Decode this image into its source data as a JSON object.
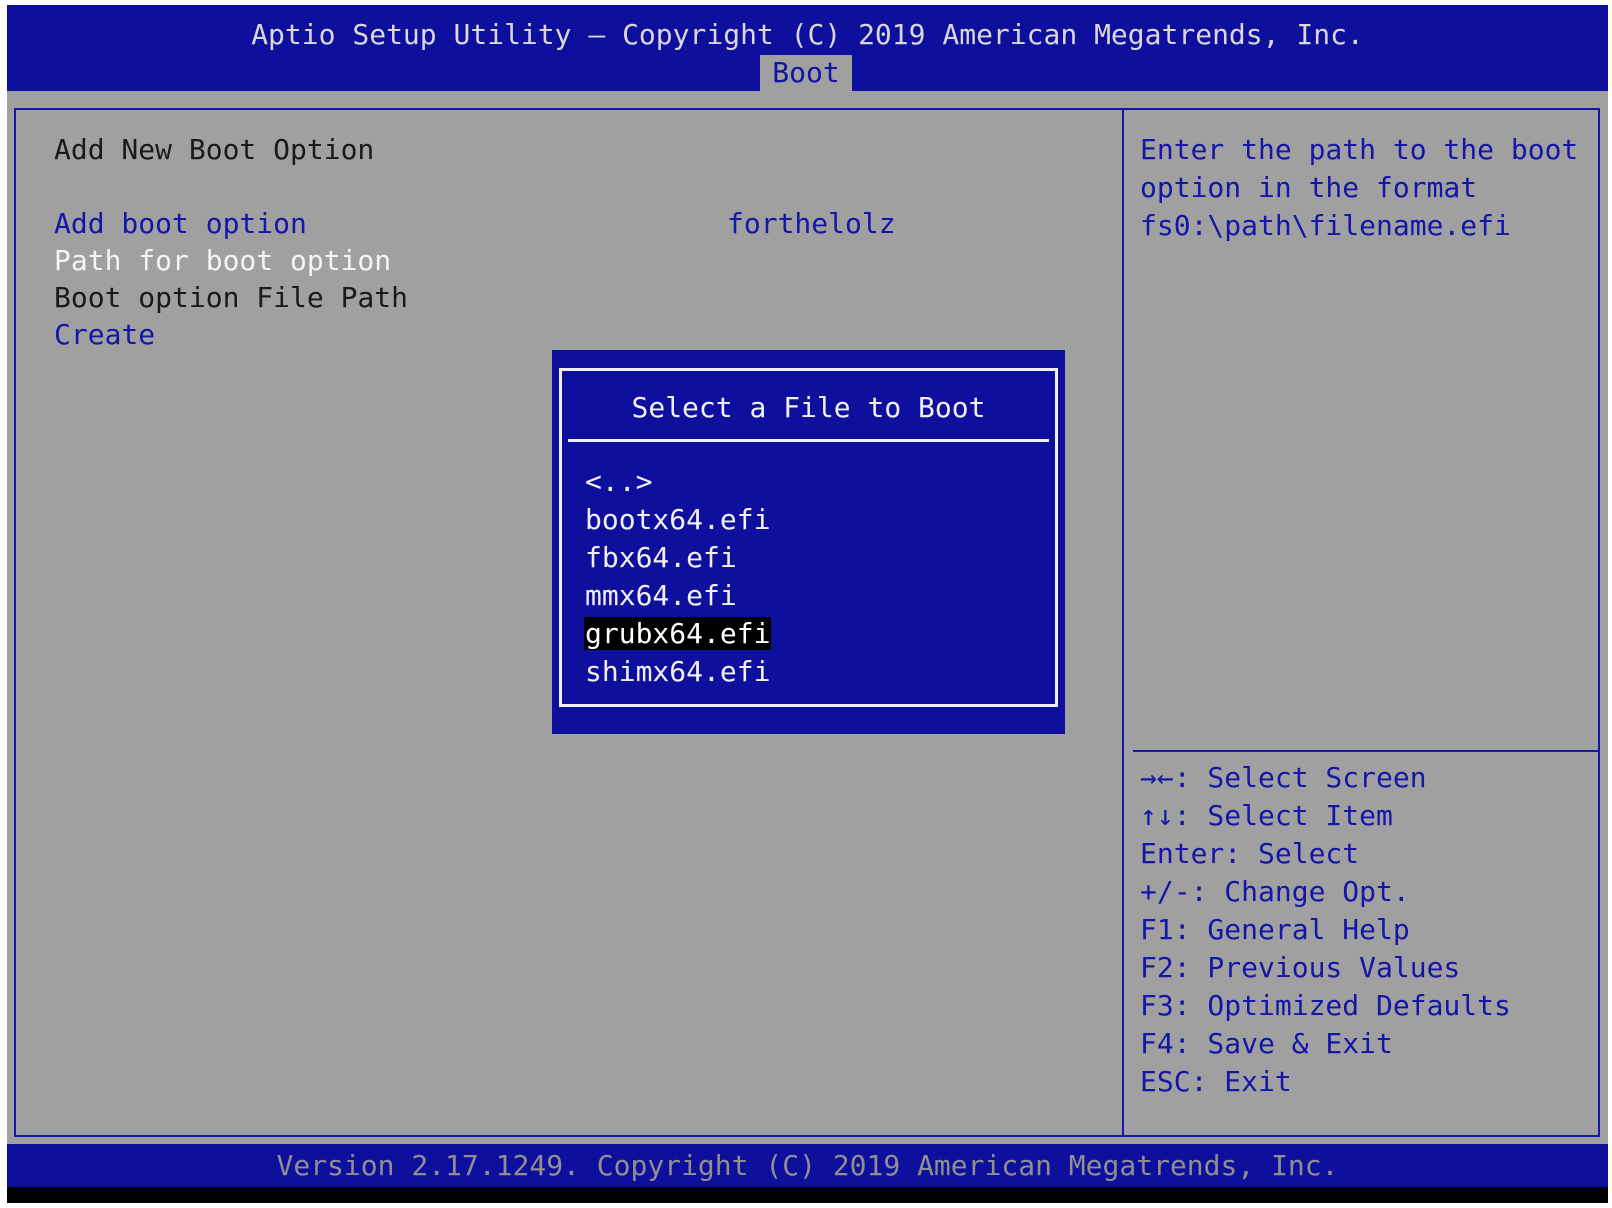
{
  "header": {
    "title": "Aptio Setup Utility – Copyright (C) 2019 American Megatrends, Inc.",
    "active_tab": "Boot"
  },
  "main": {
    "section_title": "Add New Boot Option",
    "items": [
      {
        "label": "Add boot option",
        "value": "forthelolz"
      },
      {
        "label": "Path for boot option"
      },
      {
        "label": "Boot option File Path"
      },
      {
        "label": "Create"
      }
    ]
  },
  "help": {
    "lines": [
      "Enter the path to the boot",
      "option in the format",
      "fs0:\\path\\filename.efi"
    ]
  },
  "keys": [
    "→←: Select Screen",
    "↑↓: Select Item",
    "Enter: Select",
    "+/-: Change Opt.",
    "F1: General Help",
    "F2: Previous Values",
    "F3: Optimized Defaults",
    "F4: Save & Exit",
    "ESC: Exit"
  ],
  "dialog": {
    "title": "Select a File to Boot",
    "files": [
      "<..>",
      "bootx64.efi",
      "fbx64.efi",
      "mmx64.efi",
      "grubx64.efi",
      "shimx64.efi"
    ],
    "selected": "grubx64.efi"
  },
  "footer": {
    "text": "Version 2.17.1249. Copyright (C) 2019 American Megatrends, Inc."
  }
}
